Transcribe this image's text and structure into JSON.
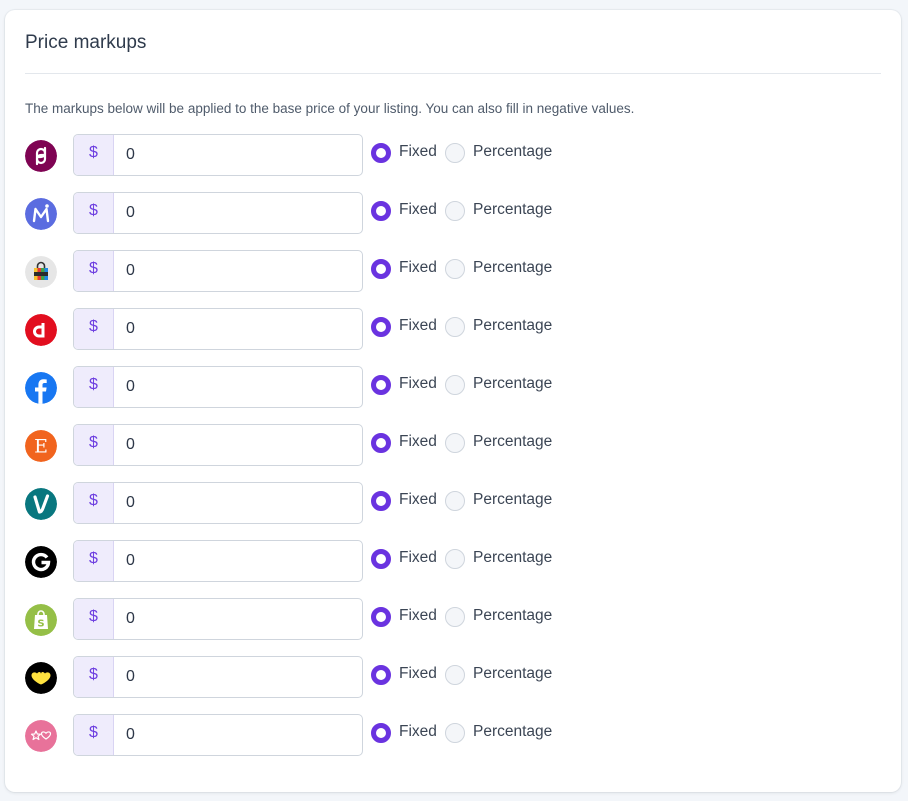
{
  "card": {
    "title": "Price markups",
    "description": "The markups below will be applied to the base price of your listing. You can also fill in negative values."
  },
  "options": {
    "fixed_label": "Fixed",
    "percentage_label": "Percentage"
  },
  "rows": [
    {
      "platform_icon": "poshmark-icon",
      "color": "#7f0353",
      "currency": "$",
      "value": "0",
      "mode": "Fixed"
    },
    {
      "platform_icon": "mercari-icon",
      "color": "#5b6ce0",
      "currency": "$",
      "value": "0",
      "mode": "Fixed"
    },
    {
      "platform_icon": "shopping-bag-icon",
      "color": "#e6e6e6",
      "currency": "$",
      "value": "0",
      "mode": "Fixed"
    },
    {
      "platform_icon": "depop-icon",
      "color": "#e20e1f",
      "currency": "$",
      "value": "0",
      "mode": "Fixed"
    },
    {
      "platform_icon": "facebook-icon",
      "color": "#1877f2",
      "currency": "$",
      "value": "0",
      "mode": "Fixed"
    },
    {
      "platform_icon": "etsy-icon",
      "color": "#f1641e",
      "currency": "$",
      "value": "0",
      "mode": "Fixed"
    },
    {
      "platform_icon": "vinted-icon",
      "color": "#09777f",
      "currency": "$",
      "value": "0",
      "mode": "Fixed"
    },
    {
      "platform_icon": "grailed-icon",
      "color": "#000000",
      "currency": "$",
      "value": "0",
      "mode": "Fixed"
    },
    {
      "platform_icon": "shopify-icon",
      "color": "#95bf47",
      "currency": "$",
      "value": "0",
      "mode": "Fixed"
    },
    {
      "platform_icon": "heart-logo-icon",
      "color": "#000000",
      "currency": "$",
      "value": "0",
      "mode": "Fixed"
    },
    {
      "platform_icon": "star-heart-icon",
      "color": "#e8729a",
      "currency": "$",
      "value": "0",
      "mode": "Fixed"
    }
  ]
}
